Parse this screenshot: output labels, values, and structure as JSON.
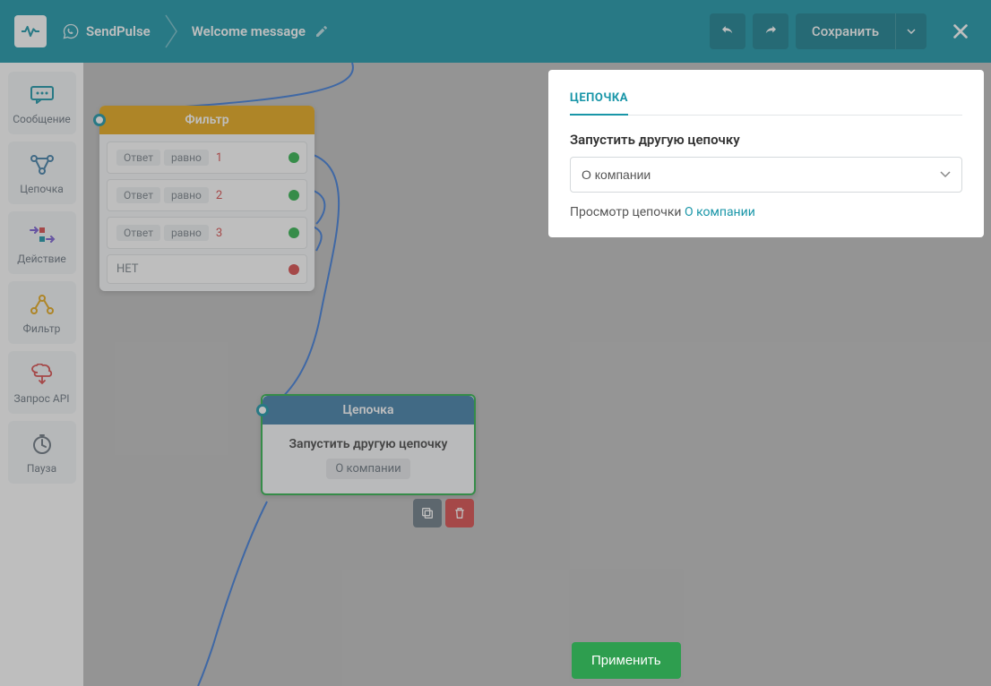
{
  "header": {
    "brand": "SendPulse",
    "flow_name": "Welcome message",
    "save_label": "Сохранить"
  },
  "sidebar": {
    "items": [
      {
        "label": "Сообщение",
        "icon": "message-icon"
      },
      {
        "label": "Цепочка",
        "icon": "chain-icon"
      },
      {
        "label": "Действие",
        "icon": "action-icon"
      },
      {
        "label": "Фильтр",
        "icon": "filter-icon"
      },
      {
        "label": "Запрос API",
        "icon": "api-icon"
      },
      {
        "label": "Пауза",
        "icon": "pause-icon"
      }
    ]
  },
  "nodes": {
    "filter": {
      "title": "Фильтр",
      "rows": [
        {
          "field": "Ответ",
          "op": "равно",
          "value": "1",
          "status": "green"
        },
        {
          "field": "Ответ",
          "op": "равно",
          "value": "2",
          "status": "green"
        },
        {
          "field": "Ответ",
          "op": "равно",
          "value": "3",
          "status": "green"
        }
      ],
      "else_label": "НЕТ"
    },
    "chain": {
      "title": "Цепочка",
      "body_title": "Запустить другую цепочку",
      "body_value": "О компании"
    }
  },
  "panel": {
    "tab": "ЦЕПОЧКА",
    "field_label": "Запустить другую цепочку",
    "select_value": "О компании",
    "preview_prefix": "Просмотр цепочки ",
    "preview_link": "О компании",
    "apply_label": "Применить"
  }
}
